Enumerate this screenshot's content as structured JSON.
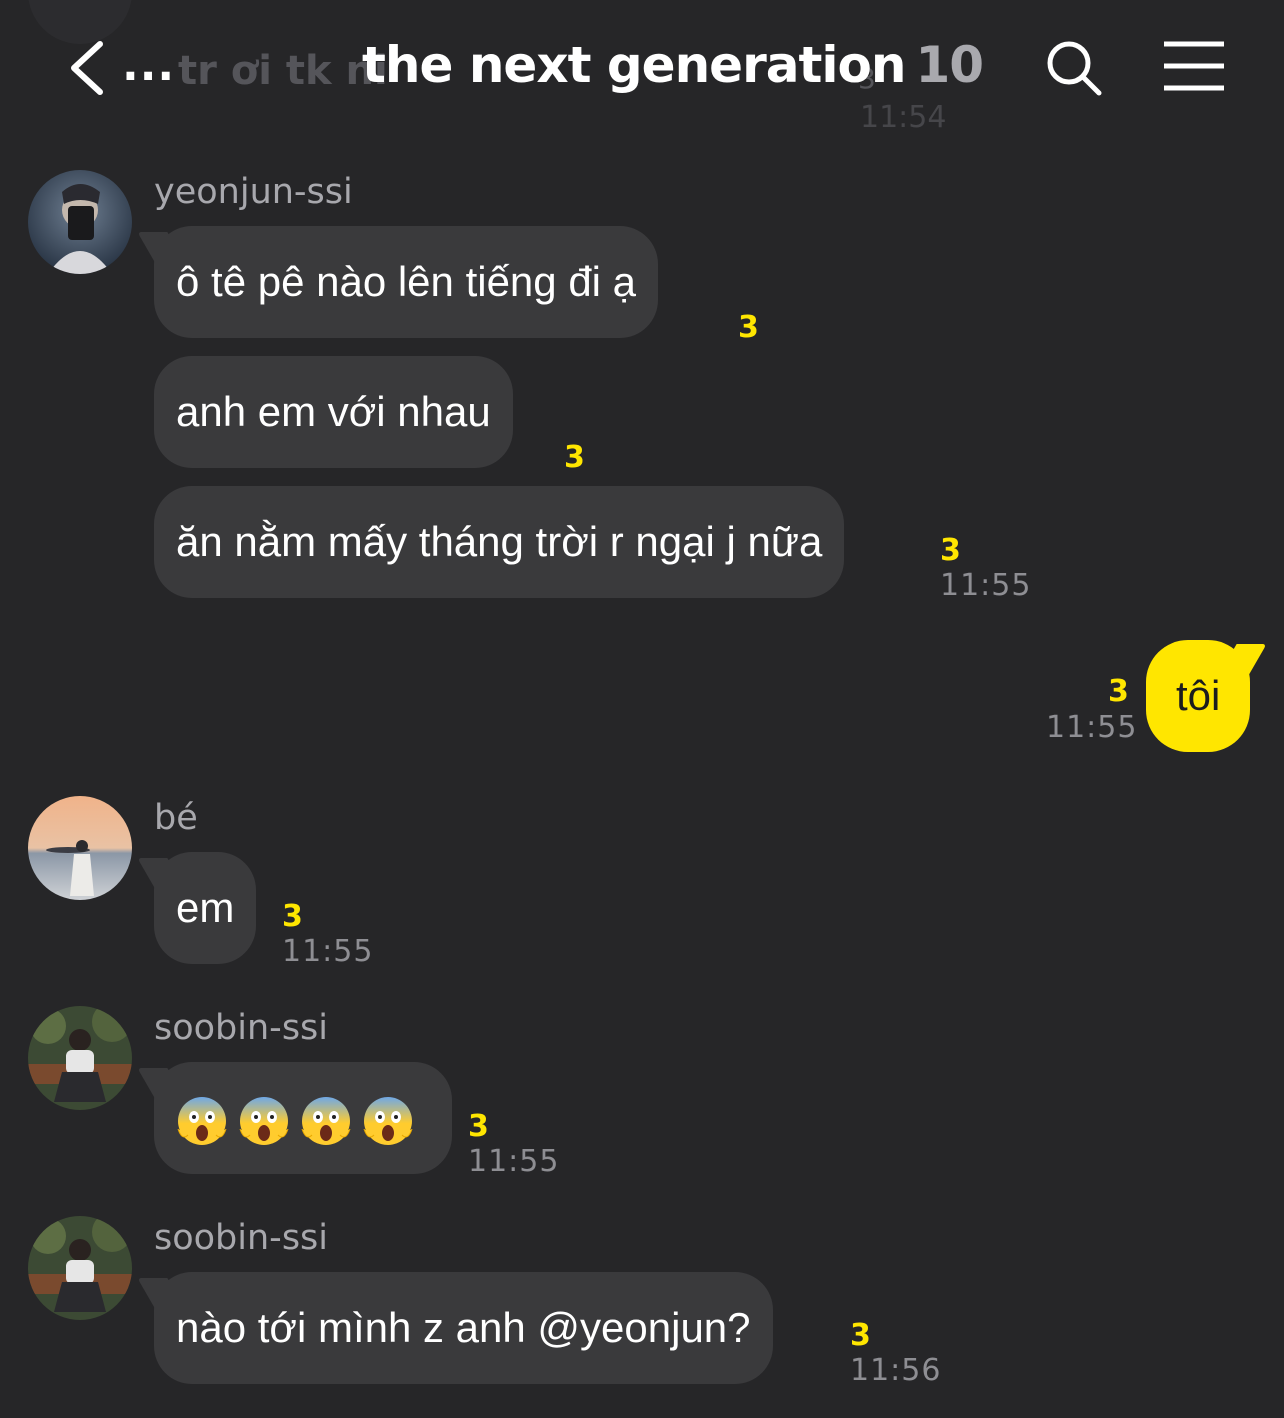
{
  "header": {
    "previous_preview": "tr ơi tk ni",
    "previous_count": "3",
    "previous_time": "11:54",
    "ellipsis": "...",
    "title": "the next generation",
    "member_count": "10"
  },
  "messages": [
    {
      "sender": "yeonjun-ssi",
      "text": "ô tê pê nào lên tiếng đi ạ",
      "unread": "3"
    },
    {
      "text": "anh em với nhau",
      "unread": "3"
    },
    {
      "text": "ăn nằm mấy tháng trời r ngại j nữa",
      "unread": "3",
      "time": "11:55"
    },
    {
      "mine": true,
      "text": "tôi",
      "unread": "3",
      "time": "11:55"
    },
    {
      "sender": "bé",
      "text": "em",
      "unread": "3",
      "time": "11:55"
    },
    {
      "sender": "soobin-ssi",
      "emoji": [
        "face-screaming-in-fear",
        "face-screaming-in-fear",
        "face-screaming-in-fear",
        "face-screaming-in-fear"
      ],
      "unread": "3",
      "time": "11:55"
    },
    {
      "sender": "soobin-ssi",
      "text": "nào tới mình z anh @yeonjun?",
      "unread": "3",
      "time": "11:56"
    }
  ],
  "colors": {
    "background": "#262628",
    "bubble": "#3a3a3c",
    "mine": "#ffe600",
    "unread": "#ffe600"
  }
}
